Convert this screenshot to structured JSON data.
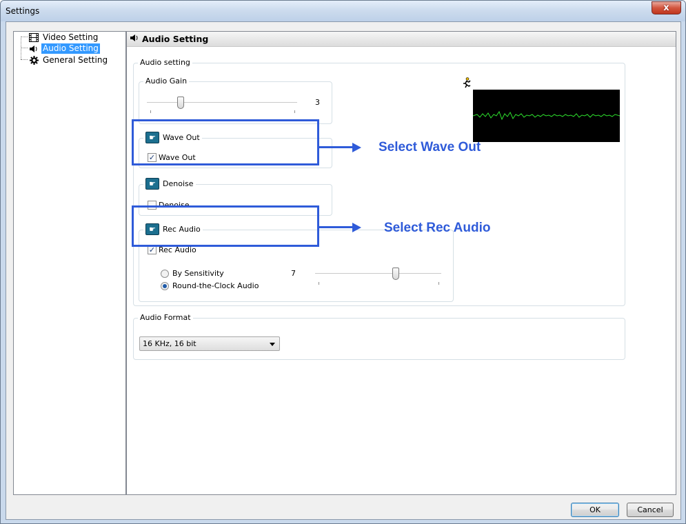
{
  "window": {
    "title": "Settings",
    "close_label": "x"
  },
  "tree": {
    "items": [
      {
        "label": "Video Setting",
        "icon": "film-icon"
      },
      {
        "label": "Audio Setting",
        "icon": "speaker-icon",
        "selected": true
      },
      {
        "label": "General Setting",
        "icon": "gear-icon"
      }
    ]
  },
  "panel": {
    "title": "Audio Setting",
    "audio_setting_group": "Audio setting",
    "audio_gain": {
      "legend": "Audio Gain",
      "value": "3"
    },
    "wave_out": {
      "legend": "Wave Out",
      "checkbox_label": "Wave Out",
      "checked": true
    },
    "denoise": {
      "legend": "Denoise",
      "checkbox_label": "Denoise",
      "checked": false
    },
    "rec_audio": {
      "legend": "Rec Audio",
      "checkbox_label": "Rec Audio",
      "checked": true,
      "by_sensitivity_label": "By Sensitivity",
      "sensitivity_value": "7",
      "round_clock_label": "Round-the-Clock Audio",
      "selected_mode": "Round-the-Clock Audio"
    },
    "audio_format": {
      "legend": "Audio Format",
      "selected": "16 KHz, 16 bit"
    }
  },
  "annotations": {
    "wave_out_callout": "Select Wave Out",
    "rec_audio_callout": "Select Rec Audio",
    "color": "#2f5bd9"
  },
  "buttons": {
    "ok": "OK",
    "cancel": "Cancel"
  }
}
